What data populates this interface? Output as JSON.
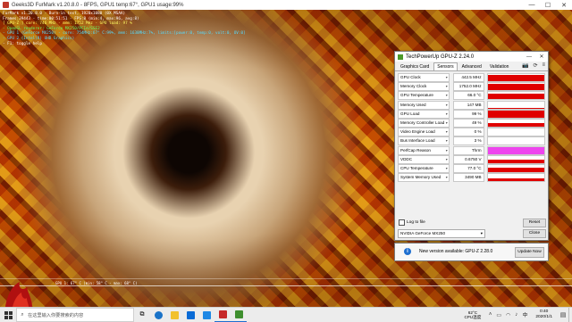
{
  "furmark": {
    "title": "Geeks3D FurMark v1.20.8.0 - 8FPS, GPU1 temp:67°, GPU1 usage:99%",
    "overlay_lines": [
      {
        "text": "FurMark v1.20.8.0 - Burn-in test, 1920x1080 (0X MSAA)",
        "color": "#ffffff"
      },
      {
        "text": "Frames:39443 - time:00:51:51 - FPS:8 (min:4, max:96, avg:8)",
        "color": "#ffffff"
      },
      {
        "text": "[ GPU-Z ] core: 746 MHz - mem: 1752 MHz - GPU load: 97 %",
        "color": "#ffff66"
      },
      {
        "text": "- OpenGL renderer: GeForce MX250/PCIe/SSE2",
        "color": "#66ff66"
      },
      {
        "text": "- GPU 1 (GeForce MX250) - core: 754MHz:67° C:99%, mem: 1638MHz:7%, limits:[power:0, temp:0, volt:0, OV:0]",
        "color": "#55ddff"
      },
      {
        "text": "- GPU 2 (Intel(R) UHD Graphics)",
        "color": "#55ddff"
      },
      {
        "text": "- F1: toggle help",
        "color": "#ffffff"
      }
    ],
    "graph_label": "GPU 1: 67° C (min: 58° C - max: 68° C)"
  },
  "gpuz": {
    "title": "TechPowerUp GPU-Z 2.24.0",
    "tabs": [
      "Graphics Card",
      "Sensors",
      "Advanced",
      "Validation"
    ],
    "active_tab": "Sensors",
    "sensors": [
      {
        "label": "GPU Clock",
        "value": "442.5 MHz",
        "fill": 0.9,
        "color": "#e00000"
      },
      {
        "label": "Memory Clock",
        "value": "1752.0 MHz",
        "fill": 0.95,
        "color": "#e00000"
      },
      {
        "label": "GPU Temperature",
        "value": "66.0 °C",
        "fill": 0.75,
        "color": "#e00000"
      },
      {
        "label": "Memory Used",
        "value": "147 MB",
        "fill": 0.1,
        "color": "#e00000"
      },
      {
        "label": "GPU Load",
        "value": "99 %",
        "fill": 0.98,
        "color": "#e00000"
      },
      {
        "label": "Memory Controller Load",
        "value": "49 %",
        "fill": 0.5,
        "color": "#e00000"
      },
      {
        "label": "Video Engine Load",
        "value": "0 %",
        "fill": 0,
        "color": "#e00000"
      },
      {
        "label": "Bus Interface Load",
        "value": "3 %",
        "fill": 0.05,
        "color": "#e00000"
      },
      {
        "label": "PerfCap Reason",
        "value": "Thrm",
        "fill": 1.0,
        "color": "#ee44ee"
      },
      {
        "label": "VDDC",
        "value": "0.6750 V",
        "fill": 0.5,
        "color": "#e00000"
      },
      {
        "label": "CPU Temperature",
        "value": "77.0 °C",
        "fill": 0.6,
        "color": "#e00000"
      },
      {
        "label": "System Memory Used",
        "value": "3490 MB",
        "fill": 0.45,
        "color": "#e00000"
      }
    ],
    "log_label": "Log to file",
    "reset_label": "Reset",
    "gpu_select": "NVIDIA GeForce MX250",
    "close_label": "Close",
    "update_text": "New version available: GPU-Z 2.28.0",
    "update_button": "Update Now"
  },
  "taskbar": {
    "search_placeholder": "在这里输入你要搜索的内容",
    "temp_value": "62°C",
    "temp_label": "CPU温度",
    "ime": "中",
    "time": "0:40",
    "date": "2020/1/1"
  }
}
